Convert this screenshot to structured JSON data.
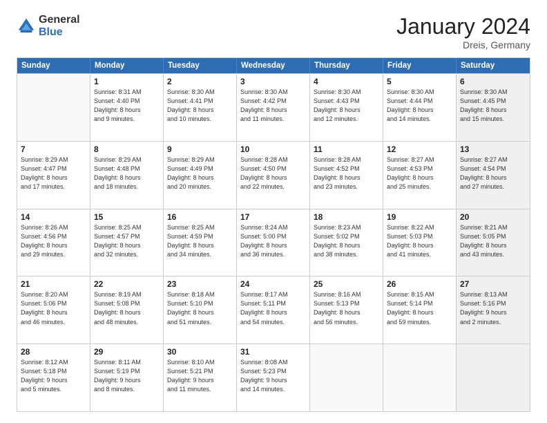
{
  "logo": {
    "general": "General",
    "blue": "Blue"
  },
  "title": {
    "month": "January 2024",
    "location": "Dreis, Germany"
  },
  "header_days": [
    "Sunday",
    "Monday",
    "Tuesday",
    "Wednesday",
    "Thursday",
    "Friday",
    "Saturday"
  ],
  "weeks": [
    [
      {
        "day": "",
        "info": "",
        "empty": true
      },
      {
        "day": "1",
        "info": "Sunrise: 8:31 AM\nSunset: 4:40 PM\nDaylight: 8 hours\nand 9 minutes."
      },
      {
        "day": "2",
        "info": "Sunrise: 8:30 AM\nSunset: 4:41 PM\nDaylight: 8 hours\nand 10 minutes."
      },
      {
        "day": "3",
        "info": "Sunrise: 8:30 AM\nSunset: 4:42 PM\nDaylight: 8 hours\nand 11 minutes."
      },
      {
        "day": "4",
        "info": "Sunrise: 8:30 AM\nSunset: 4:43 PM\nDaylight: 8 hours\nand 12 minutes."
      },
      {
        "day": "5",
        "info": "Sunrise: 8:30 AM\nSunset: 4:44 PM\nDaylight: 8 hours\nand 14 minutes."
      },
      {
        "day": "6",
        "info": "Sunrise: 8:30 AM\nSunset: 4:45 PM\nDaylight: 8 hours\nand 15 minutes.",
        "shaded": true
      }
    ],
    [
      {
        "day": "7",
        "info": "Sunrise: 8:29 AM\nSunset: 4:47 PM\nDaylight: 8 hours\nand 17 minutes."
      },
      {
        "day": "8",
        "info": "Sunrise: 8:29 AM\nSunset: 4:48 PM\nDaylight: 8 hours\nand 18 minutes."
      },
      {
        "day": "9",
        "info": "Sunrise: 8:29 AM\nSunset: 4:49 PM\nDaylight: 8 hours\nand 20 minutes."
      },
      {
        "day": "10",
        "info": "Sunrise: 8:28 AM\nSunset: 4:50 PM\nDaylight: 8 hours\nand 22 minutes."
      },
      {
        "day": "11",
        "info": "Sunrise: 8:28 AM\nSunset: 4:52 PM\nDaylight: 8 hours\nand 23 minutes."
      },
      {
        "day": "12",
        "info": "Sunrise: 8:27 AM\nSunset: 4:53 PM\nDaylight: 8 hours\nand 25 minutes."
      },
      {
        "day": "13",
        "info": "Sunrise: 8:27 AM\nSunset: 4:54 PM\nDaylight: 8 hours\nand 27 minutes.",
        "shaded": true
      }
    ],
    [
      {
        "day": "14",
        "info": "Sunrise: 8:26 AM\nSunset: 4:56 PM\nDaylight: 8 hours\nand 29 minutes."
      },
      {
        "day": "15",
        "info": "Sunrise: 8:25 AM\nSunset: 4:57 PM\nDaylight: 8 hours\nand 32 minutes."
      },
      {
        "day": "16",
        "info": "Sunrise: 8:25 AM\nSunset: 4:59 PM\nDaylight: 8 hours\nand 34 minutes."
      },
      {
        "day": "17",
        "info": "Sunrise: 8:24 AM\nSunset: 5:00 PM\nDaylight: 8 hours\nand 36 minutes."
      },
      {
        "day": "18",
        "info": "Sunrise: 8:23 AM\nSunset: 5:02 PM\nDaylight: 8 hours\nand 38 minutes."
      },
      {
        "day": "19",
        "info": "Sunrise: 8:22 AM\nSunset: 5:03 PM\nDaylight: 8 hours\nand 41 minutes."
      },
      {
        "day": "20",
        "info": "Sunrise: 8:21 AM\nSunset: 5:05 PM\nDaylight: 8 hours\nand 43 minutes.",
        "shaded": true
      }
    ],
    [
      {
        "day": "21",
        "info": "Sunrise: 8:20 AM\nSunset: 5:06 PM\nDaylight: 8 hours\nand 46 minutes."
      },
      {
        "day": "22",
        "info": "Sunrise: 8:19 AM\nSunset: 5:08 PM\nDaylight: 8 hours\nand 48 minutes."
      },
      {
        "day": "23",
        "info": "Sunrise: 8:18 AM\nSunset: 5:10 PM\nDaylight: 8 hours\nand 51 minutes."
      },
      {
        "day": "24",
        "info": "Sunrise: 8:17 AM\nSunset: 5:11 PM\nDaylight: 8 hours\nand 54 minutes."
      },
      {
        "day": "25",
        "info": "Sunrise: 8:16 AM\nSunset: 5:13 PM\nDaylight: 8 hours\nand 56 minutes."
      },
      {
        "day": "26",
        "info": "Sunrise: 8:15 AM\nSunset: 5:14 PM\nDaylight: 8 hours\nand 59 minutes."
      },
      {
        "day": "27",
        "info": "Sunrise: 8:13 AM\nSunset: 5:16 PM\nDaylight: 9 hours\nand 2 minutes.",
        "shaded": true
      }
    ],
    [
      {
        "day": "28",
        "info": "Sunrise: 8:12 AM\nSunset: 5:18 PM\nDaylight: 9 hours\nand 5 minutes."
      },
      {
        "day": "29",
        "info": "Sunrise: 8:11 AM\nSunset: 5:19 PM\nDaylight: 9 hours\nand 8 minutes."
      },
      {
        "day": "30",
        "info": "Sunrise: 8:10 AM\nSunset: 5:21 PM\nDaylight: 9 hours\nand 11 minutes."
      },
      {
        "day": "31",
        "info": "Sunrise: 8:08 AM\nSunset: 5:23 PM\nDaylight: 9 hours\nand 14 minutes."
      },
      {
        "day": "",
        "info": "",
        "empty": true
      },
      {
        "day": "",
        "info": "",
        "empty": true
      },
      {
        "day": "",
        "info": "",
        "empty": true,
        "shaded": true
      }
    ]
  ]
}
